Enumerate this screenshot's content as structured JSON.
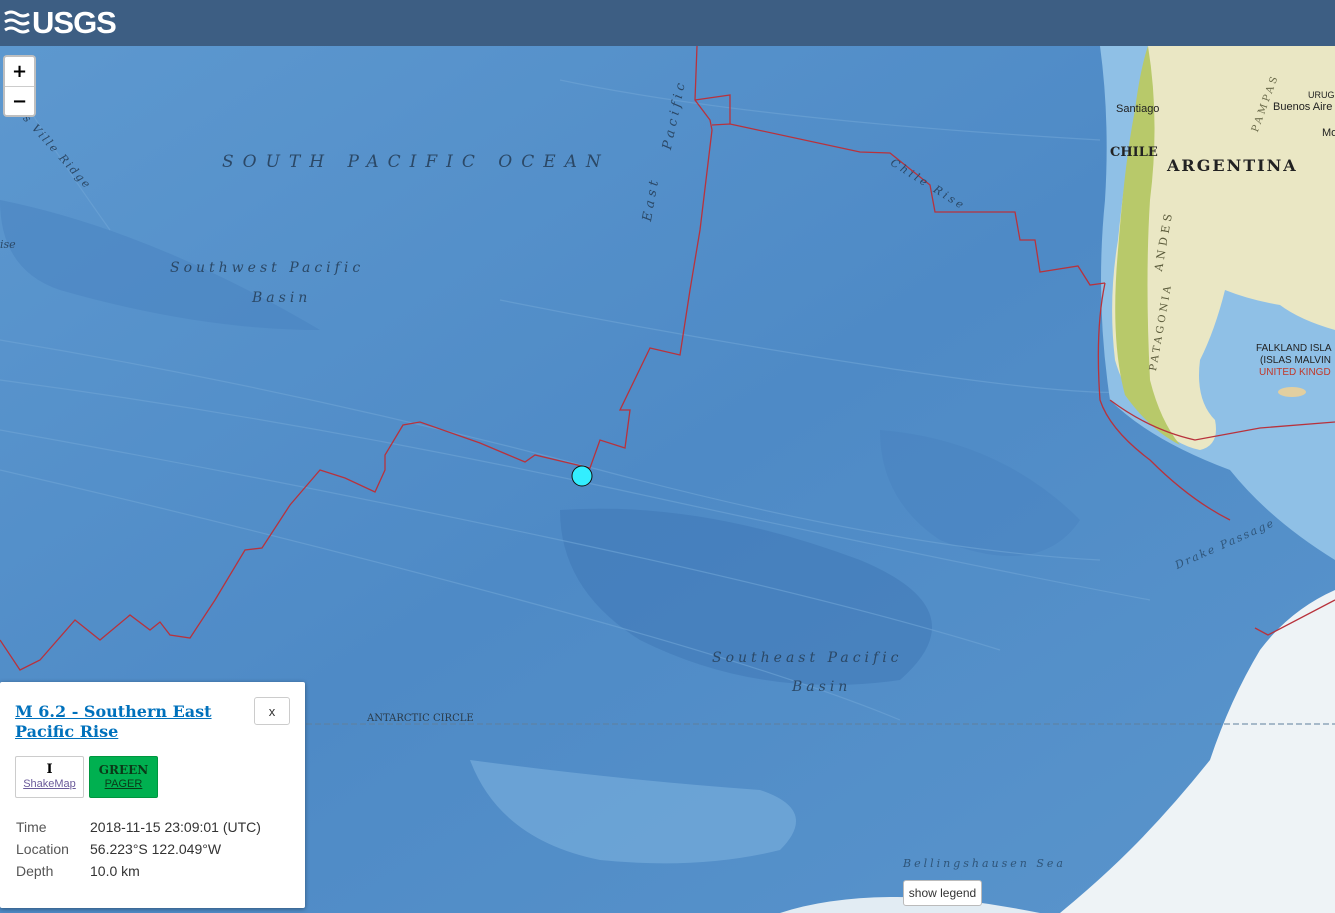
{
  "header": {
    "logo_text": "USGS"
  },
  "zoom": {
    "in_label": "+",
    "out_label": "−"
  },
  "map_labels": {
    "ocean": "SOUTH PACIFIC OCEAN",
    "sw_basin_line1": "Southwest Pacific",
    "sw_basin_line2": "Basin",
    "se_basin_line1": "Southeast Pacific",
    "se_basin_line2": "Basin",
    "east_pacific_1": "East",
    "east_pacific_2": "Pacific",
    "chile_rise": "Chile Rise",
    "ridge": "s Ville Ridge",
    "rise_partial": "ise",
    "antarctic_circle": "ANTARCTIC CIRCLE",
    "drake_passage": "Drake Passage",
    "bellingshausen": "Bellingshausen Sea",
    "andes": "ANDES",
    "patagonia": "PATAGONIA",
    "pampas": "PAMPAS"
  },
  "places": {
    "santiago": "Santiago",
    "buenos_aires": "Buenos Aire",
    "uruguay": "URUG",
    "mo": "Mo",
    "chile": "CHILE",
    "argentina": "ARGENTINA",
    "falkland_1": "FALKLAND ISLA",
    "falkland_2": "(ISLAS MALVIN",
    "falkland_3": "UNITED KINGD"
  },
  "popup": {
    "title": "M 6.2 - Southern East Pacific Rise",
    "close_label": "x",
    "shakemap_value": "I",
    "shakemap_label": "ShakeMap",
    "pager_value": "GREEN",
    "pager_label": "PAGER",
    "time_label": "Time",
    "time_value": "2018-11-15 23:09:01 (UTC)",
    "location_label": "Location",
    "location_value": "56.223°S 122.049°W",
    "depth_label": "Depth",
    "depth_value": "10.0 km"
  },
  "legend_button": "show legend",
  "colors": {
    "header": "#3d5e83",
    "ocean": "#4a86c2",
    "plate_boundary": "#b8323c",
    "epicenter": "#33eeff",
    "pager_green": "#00b050",
    "link": "#0071bc"
  }
}
